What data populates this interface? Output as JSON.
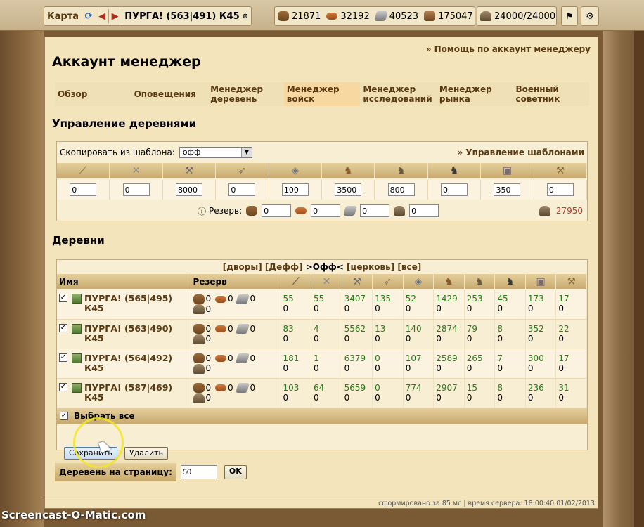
{
  "topbar": {
    "map_label": "Карта",
    "village": "ПУРГА! (563|491) К45",
    "resources": [
      {
        "icon": "wood-icon",
        "value": "21871"
      },
      {
        "icon": "clay-icon",
        "value": "32192"
      },
      {
        "icon": "iron-icon",
        "value": "40523"
      },
      {
        "icon": "storage-icon",
        "value": "175047"
      }
    ],
    "population": "24000/24000"
  },
  "page": {
    "help_link": "» Помощь по аккаунт менеджеру",
    "title": "Аккаунт менеджер",
    "tabs": [
      "Обзор",
      "Оповещения",
      "Менеджер деревень",
      "Менеджер войск",
      "Менеджер исследований",
      "Менеджер рынка",
      "Военный советник"
    ],
    "active_tab": 3,
    "manage_title": "Управление деревнями",
    "copy_label": "Скопировать из шаблона:",
    "template_value": "офф",
    "manage_templates": "» Управление шаблонами",
    "unit_icons": [
      "spear-icon",
      "sword-icon",
      "axe-icon",
      "archer-icon",
      "scout-icon",
      "light-cavalry-icon",
      "mounted-archer-icon",
      "heavy-cavalry-icon",
      "ram-icon",
      "catapult-icon"
    ],
    "template_units": [
      "0",
      "0",
      "8000",
      "0",
      "100",
      "3500",
      "800",
      "0",
      "350",
      "0"
    ],
    "reserve_label": "Резерв:",
    "reserve_values": [
      "0",
      "0",
      "0",
      "0"
    ],
    "farm_total": "27950",
    "villages_title": "Деревни",
    "filters": {
      "f1": "[дворы]",
      "f2": "[Дефф]",
      "f3": ">Офф<",
      "f4": "[церковь]",
      "f5": "[все]"
    },
    "col_name": "Имя",
    "col_reserve": "Резерв",
    "villages": [
      {
        "name": "ПУРГА! (565|495) К45",
        "res": [
          "0",
          "0",
          "0",
          "0"
        ],
        "units": [
          "55",
          "55",
          "3407",
          "135",
          "52",
          "1429",
          "253",
          "45",
          "173",
          "17"
        ]
      },
      {
        "name": "ПУРГА! (563|490) К45",
        "res": [
          "0",
          "0",
          "0",
          "0"
        ],
        "units": [
          "83",
          "4",
          "5562",
          "13",
          "140",
          "2874",
          "79",
          "8",
          "352",
          "22"
        ]
      },
      {
        "name": "ПУРГА! (564|492) К45",
        "res": [
          "0",
          "0",
          "0",
          "0"
        ],
        "units": [
          "181",
          "1",
          "6379",
          "0",
          "107",
          "2589",
          "265",
          "7",
          "300",
          "17"
        ]
      },
      {
        "name": "ПУРГА! (587|469) К45",
        "res": [
          "0",
          "0",
          "0",
          "0"
        ],
        "units": [
          "103",
          "64",
          "5659",
          "0",
          "774",
          "2907",
          "15",
          "8",
          "236",
          "31"
        ]
      }
    ],
    "unit_zero": "0",
    "select_all": "Выбрать все",
    "save_btn": "Сохранить",
    "delete_btn": "Удалить",
    "per_page_label": "Деревень на страницу:",
    "per_page_value": "50",
    "ok_btn": "OK",
    "footer": "сформировано за 85 мс | время сервера: 18:00:40 01/02/2013"
  },
  "watermark": "Screencast-O-Matic.com"
}
